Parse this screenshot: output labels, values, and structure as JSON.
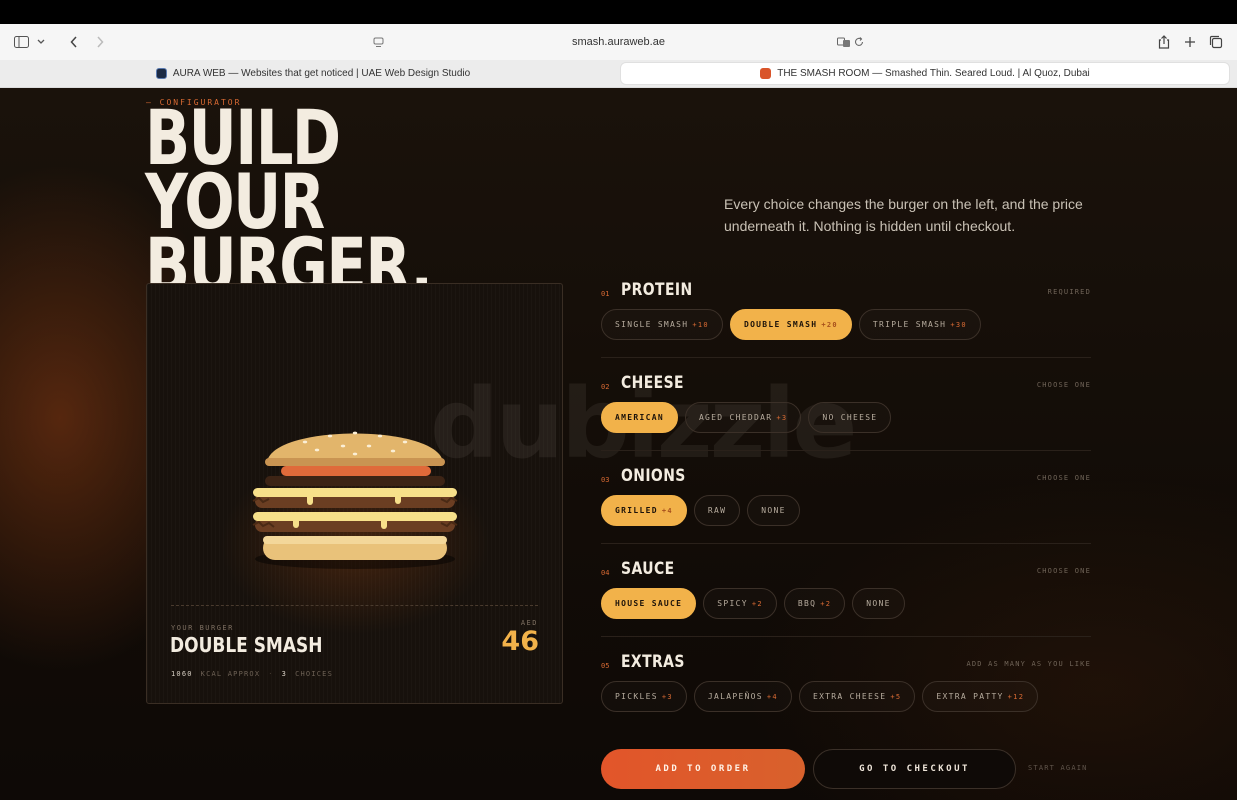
{
  "browser": {
    "url": "smash.auraweb.ae",
    "tabs": [
      {
        "title": "AURA WEB — Websites that get noticed | UAE Web Design Studio",
        "active": false
      },
      {
        "title": "THE SMASH ROOM — Smashed Thin. Seared Loud. | Al Quoz, Dubai",
        "active": true
      }
    ]
  },
  "hero": {
    "eyebrow": "— CONFIGURATOR",
    "title": "BUILD YOUR\nBURGER.",
    "description": "Every choice changes the burger on the left, and the price underneath it. Nothing is hidden until checkout."
  },
  "preview": {
    "label": "YOUR BURGER",
    "name": "DOUBLE SMASH",
    "currency": "AED",
    "price": "46",
    "kcal": "1060",
    "kcal_label": "KCAL APPROX",
    "choices": "3",
    "choices_label": "CHOICES"
  },
  "sections": [
    {
      "num": "01",
      "title": "PROTEIN",
      "rule": "REQUIRED",
      "options": [
        {
          "label": "SINGLE SMASH",
          "price": "+10",
          "selected": false
        },
        {
          "label": "DOUBLE SMASH",
          "price": "+20",
          "selected": true
        },
        {
          "label": "TRIPLE SMASH",
          "price": "+30",
          "selected": false
        }
      ]
    },
    {
      "num": "02",
      "title": "CHEESE",
      "rule": "CHOOSE ONE",
      "options": [
        {
          "label": "AMERICAN",
          "price": "",
          "selected": true
        },
        {
          "label": "AGED CHEDDAR",
          "price": "+3",
          "selected": false
        },
        {
          "label": "NO CHEESE",
          "price": "",
          "selected": false
        }
      ]
    },
    {
      "num": "03",
      "title": "ONIONS",
      "rule": "CHOOSE ONE",
      "options": [
        {
          "label": "GRILLED",
          "price": "+4",
          "selected": true
        },
        {
          "label": "RAW",
          "price": "",
          "selected": false
        },
        {
          "label": "NONE",
          "price": "",
          "selected": false
        }
      ]
    },
    {
      "num": "04",
      "title": "SAUCE",
      "rule": "CHOOSE ONE",
      "options": [
        {
          "label": "HOUSE SAUCE",
          "price": "",
          "selected": true
        },
        {
          "label": "SPICY",
          "price": "+2",
          "selected": false
        },
        {
          "label": "BBQ",
          "price": "+2",
          "selected": false
        },
        {
          "label": "NONE",
          "price": "",
          "selected": false
        }
      ]
    },
    {
      "num": "05",
      "title": "EXTRAS",
      "rule": "ADD AS MANY AS YOU LIKE",
      "options": [
        {
          "label": "PICKLES",
          "price": "+3",
          "selected": false
        },
        {
          "label": "JALAPEÑOS",
          "price": "+4",
          "selected": false
        },
        {
          "label": "EXTRA CHEESE",
          "price": "+5",
          "selected": false
        },
        {
          "label": "EXTRA PATTY",
          "price": "+12",
          "selected": false
        }
      ]
    }
  ],
  "actions": {
    "add": "ADD TO ORDER",
    "checkout": "GO TO CHECKOUT",
    "reset": "START AGAIN"
  },
  "watermark": "dubizzle",
  "colors": {
    "accent": "#f2b24a",
    "orange": "#d96a33",
    "cta": "#e2552a",
    "bg": "#120c07"
  }
}
